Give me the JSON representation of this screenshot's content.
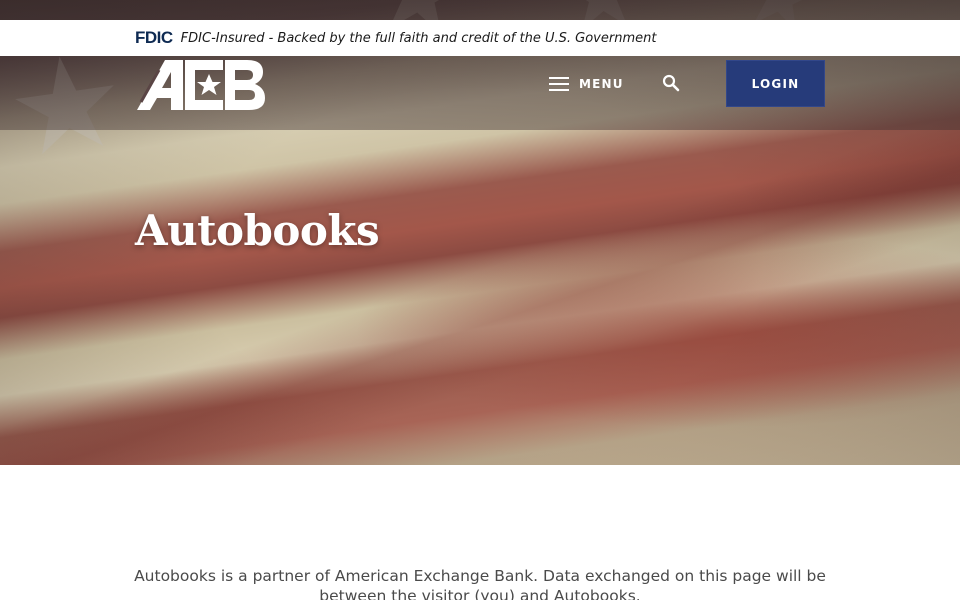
{
  "fdic": {
    "logo_text": "FDIC",
    "notice": "FDIC-Insured - Backed by the full faith and credit of the U.S. Government"
  },
  "header": {
    "logo_alt": "AEB",
    "menu_label": "MENU",
    "search_icon": "search-icon",
    "login_label": "LOGIN",
    "login_color": "#263b7a"
  },
  "hero": {
    "title": "Autobooks"
  },
  "content": {
    "intro": "Autobooks is a partner of American Exchange Bank. Data exchanged on this page will be between the visitor (you) and Autobooks."
  }
}
